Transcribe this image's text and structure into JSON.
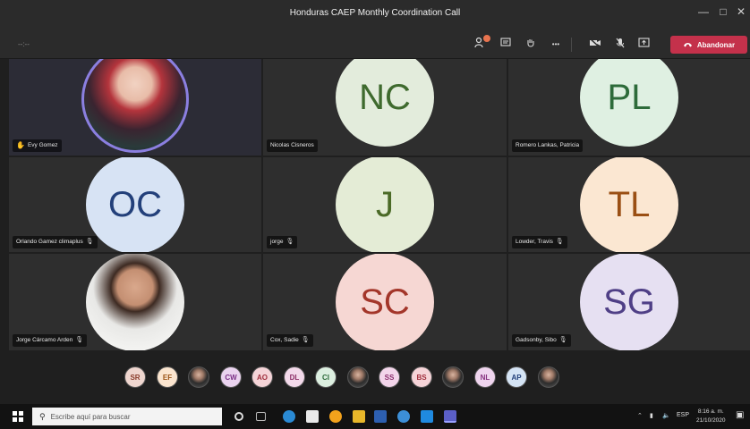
{
  "window": {
    "title": "Honduras CAEP Monthly Coordination Call",
    "minimize": "—",
    "maximize": "□",
    "close": "✕"
  },
  "toolbar": {
    "timer": "--:--",
    "more": "•••",
    "leave_label": "Abandonar",
    "leave_color": "#c4314b"
  },
  "tiles": [
    {
      "name": "Evy Gomez",
      "photo": "woman",
      "hand_raised": true,
      "muted": false
    },
    {
      "name": "Nicolas Cisneros",
      "initials": "NC",
      "bg": "#e3ecdc",
      "fg": "#3f6a2e",
      "muted": false
    },
    {
      "name": "Romero Lankas, Patricia",
      "initials": "PL",
      "bg": "#dff0e2",
      "fg": "#2d6b3a",
      "muted": false
    },
    {
      "name": "Orlando Gamez climaplus",
      "initials": "OC",
      "bg": "#d7e3f4",
      "fg": "#23407a",
      "muted": true
    },
    {
      "name": "jorge",
      "initials": "J",
      "bg": "#e4ecd6",
      "fg": "#4b6a27",
      "muted": true
    },
    {
      "name": "Lowder, Travis",
      "initials": "TL",
      "bg": "#fbe7d2",
      "fg": "#9a4f14",
      "muted": true
    },
    {
      "name": "Jorge Cárcamo Arden",
      "photo": "man",
      "muted": true
    },
    {
      "name": "Cox, Sadie",
      "initials": "SC",
      "bg": "#f6d7d3",
      "fg": "#a3362a",
      "muted": true
    },
    {
      "name": "Gadsonby, Sibo",
      "initials": "SG",
      "bg": "#e6e0f2",
      "fg": "#4f3f86",
      "muted": true
    }
  ],
  "participants_strip": [
    {
      "initials": "SR",
      "bg": "#efd6cf",
      "fg": "#8a3c2c"
    },
    {
      "initials": "EF",
      "bg": "#fbe5cf",
      "fg": "#9a5214"
    },
    {
      "initials": "",
      "photo": true
    },
    {
      "initials": "CW",
      "bg": "#ead3ef",
      "fg": "#7a2f86"
    },
    {
      "initials": "AO",
      "bg": "#f5d4d8",
      "fg": "#a02f3d"
    },
    {
      "initials": "DL",
      "bg": "#f3d9ea",
      "fg": "#8b2e66"
    },
    {
      "initials": "CI",
      "bg": "#dcefe0",
      "fg": "#2d6b3a"
    },
    {
      "initials": "",
      "photo": true
    },
    {
      "initials": "SS",
      "bg": "#f3d5ea",
      "fg": "#8a2d6c"
    },
    {
      "initials": "BS",
      "bg": "#f6d4d8",
      "fg": "#a12f3d"
    },
    {
      "initials": "",
      "photo": true
    },
    {
      "initials": "NL",
      "bg": "#efd4ee",
      "fg": "#86307f"
    },
    {
      "initials": "AP",
      "bg": "#d5e4f5",
      "fg": "#23407a"
    },
    {
      "initials": "",
      "photo": true
    }
  ],
  "taskbar": {
    "search_placeholder": "Escribe aquí para buscar",
    "tray_lang": "ESP",
    "clock_time": "8:16 a. m.",
    "clock_date": "21/10/2020"
  }
}
